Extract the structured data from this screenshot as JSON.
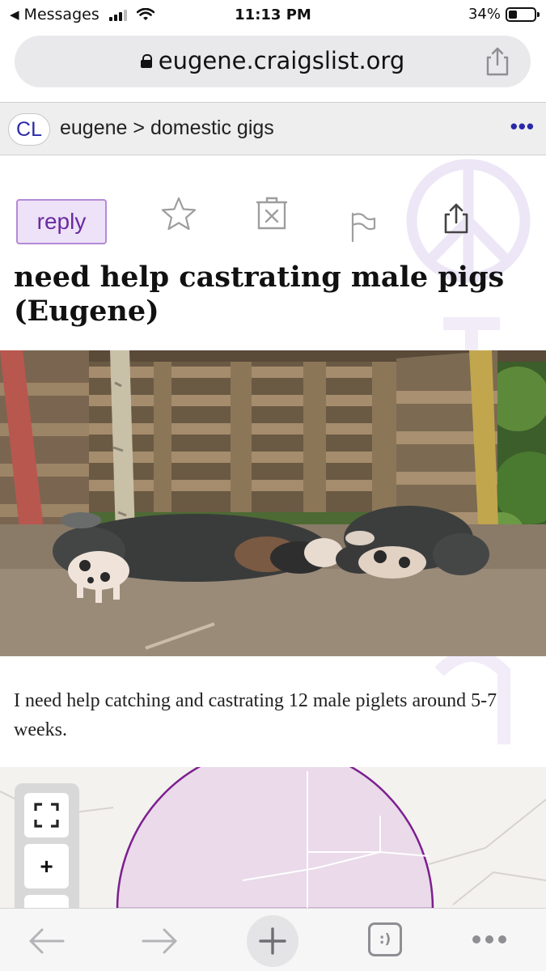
{
  "status_bar": {
    "back_app": "Messages",
    "time": "11:13 PM",
    "battery": "34%"
  },
  "address_bar": {
    "url": "eugene.craigslist.org"
  },
  "header": {
    "logo": "CL",
    "breadcrumb_city": "eugene",
    "breadcrumb_separator": ">",
    "breadcrumb_category": "domestic gigs",
    "menu": "•••"
  },
  "actions": {
    "reply_label": "reply"
  },
  "post": {
    "title": "need help castrating male pigs (Eugene)",
    "body": "I need help catching and castrating 12 male piglets around 5-7 weeks."
  },
  "map_controls": {
    "zoom_in": "+"
  },
  "toolbar": {
    "tabs_label": ":)"
  },
  "colors": {
    "accent": "#6a2ba0",
    "reply_bg": "#ede2f7",
    "header_bg": "#eeeeee",
    "map_circle": "#7d1f8f"
  }
}
